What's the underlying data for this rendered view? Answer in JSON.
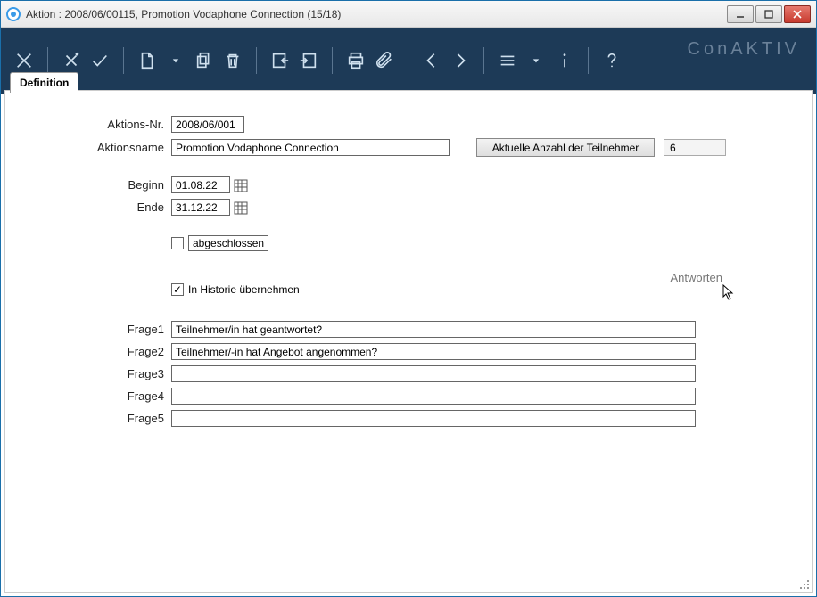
{
  "window": {
    "title": "Aktion : 2008/06/00115, Promotion Vodaphone Connection (15/18)"
  },
  "brand": "ConAKTIV",
  "tab": {
    "label": "Definition"
  },
  "form": {
    "aktions_nr_label": "Aktions-Nr.",
    "aktions_nr": "2008/06/001",
    "aktionsname_label": "Aktionsname",
    "aktionsname": "Promotion Vodaphone Connection",
    "btn_teilnehmer": "Aktuelle Anzahl der Teilnehmer",
    "teilnehmer_count": "6",
    "beginn_label": "Beginn",
    "beginn": "01.08.22",
    "ende_label": "Ende",
    "ende": "31.12.22",
    "abgeschlossen_label": "abgeschlossen",
    "abgeschlossen_checked": false,
    "historie_label": "In Historie übernehmen",
    "historie_checked": true,
    "antworten_label": "Antworten",
    "frage_labels": [
      "Frage1",
      "Frage2",
      "Frage3",
      "Frage4",
      "Frage5"
    ],
    "frage_values": [
      "Teilnehmer/in hat geantwortet?",
      "Teilnehmer/-in hat Angebot angenommen?",
      "",
      "",
      ""
    ]
  }
}
